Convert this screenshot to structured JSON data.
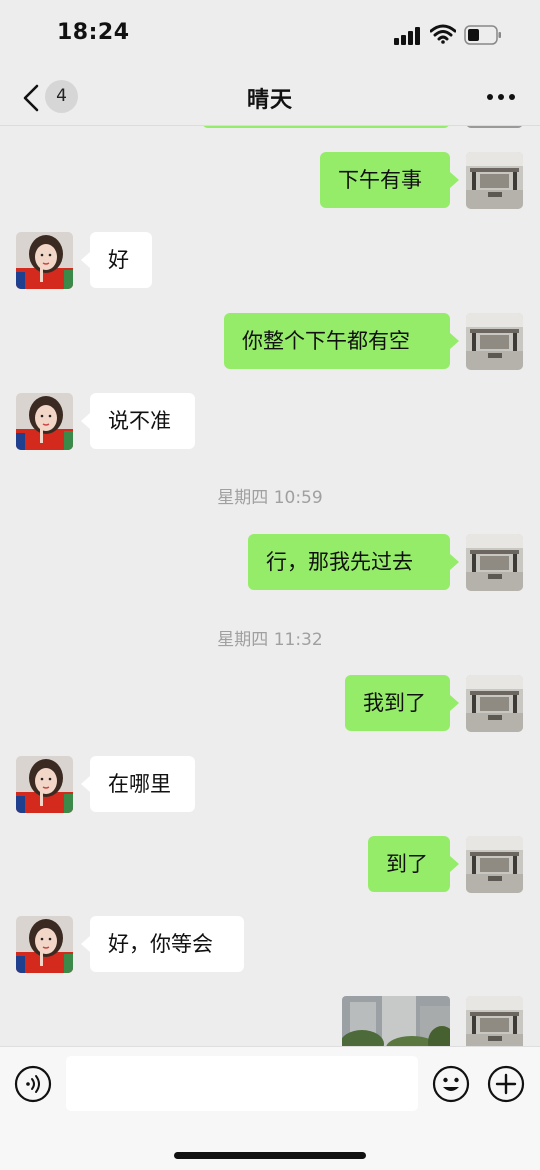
{
  "status_bar": {
    "time": "18:24",
    "signal_icon": "cellular-signal-icon",
    "wifi_icon": "wifi-icon",
    "battery_icon": "battery-icon"
  },
  "nav": {
    "unread_count": "4",
    "title": "晴天",
    "back_icon": "chevron-left-icon",
    "more_icon": "more-dots-icon"
  },
  "colors": {
    "outgoing_bubble": "#95ec69",
    "incoming_bubble": "#ffffff",
    "background": "#ededed"
  },
  "messages": [
    {
      "dir": "out",
      "text": "下午有事"
    },
    {
      "dir": "in",
      "text": "好"
    },
    {
      "dir": "out",
      "text": "你整个下午都有空"
    },
    {
      "dir": "in",
      "text": "说不准"
    },
    {
      "dir": "time",
      "text": "星期四 10:59"
    },
    {
      "dir": "out",
      "text": "行，那我先过去"
    },
    {
      "dir": "time",
      "text": "星期四 11:32"
    },
    {
      "dir": "out",
      "text": "我到了"
    },
    {
      "dir": "in",
      "text": "在哪里"
    },
    {
      "dir": "out",
      "text": "到了"
    },
    {
      "dir": "in",
      "text": "好，你等会"
    },
    {
      "dir": "out",
      "type": "image",
      "text": ""
    }
  ],
  "input": {
    "voice_icon": "voice-icon",
    "emoji_icon": "emoji-icon",
    "plus_icon": "plus-icon",
    "placeholder": ""
  }
}
